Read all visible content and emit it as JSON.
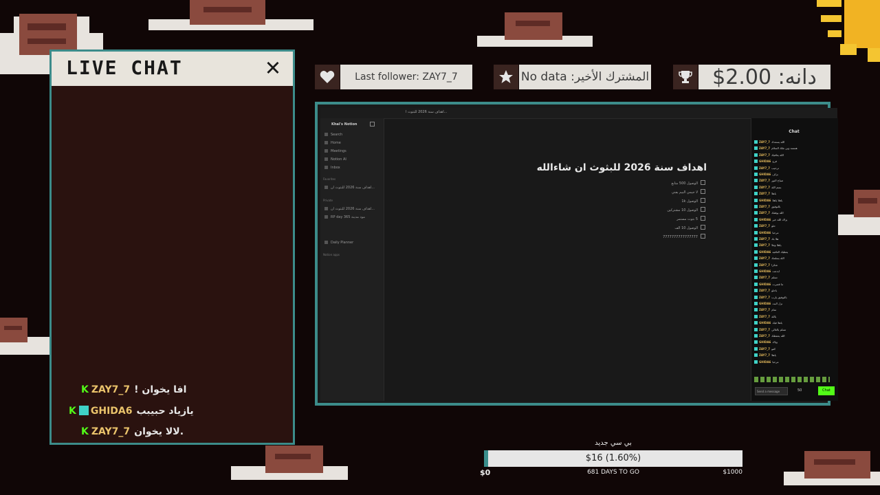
{
  "chat": {
    "title": "LIVE CHAT",
    "close_label": "✕",
    "messages": [
      {
        "platform": "K",
        "username": "ZAY7_7",
        "text": "! افا يخوان"
      },
      {
        "platform": "K",
        "username": "GHIDA6",
        "text": "يازياد حبيبب"
      },
      {
        "platform": "K",
        "username": "ZAY7_7",
        "text": "لالا يخوان."
      }
    ]
  },
  "stats": {
    "follower": {
      "icon": "heart-icon",
      "text": "Last follower: ZAY7_7"
    },
    "subscriber": {
      "icon": "star-icon",
      "text": "المشترك الأخير: No data"
    },
    "donation": {
      "icon": "trophy-icon",
      "text": "دانه: 2.00$"
    }
  },
  "app": {
    "workspace_name": "Khal's Notion",
    "tab_title": "اهداف سنة 2026 للبثوث ا...",
    "sidebar_items": [
      "Search",
      "Home",
      "Meetings",
      "Notion AI",
      "Inbox"
    ],
    "favorites_header": "Favorites",
    "favorites": [
      "اهداف سنة 2026 للبثوث ان..."
    ],
    "private_header": "Private",
    "private_items": [
      "اهداف سنة 2026 للبثوث ان...",
      "RP day 365 مود مدينة"
    ],
    "more_items": [
      "Daily Planner"
    ],
    "footer": "Notion apps",
    "doc_title": "اهداف سنة 2026 للبثوث ان شاءالله",
    "goals": [
      "الوصول 500 متابع",
      "لا جيمي البيم يفني",
      "الوصول 1k",
      "الوصول 10 مشتركين",
      "5 بثوث مستمر",
      "الوصول 10 الف",
      "7777777777777777"
    ]
  },
  "twitch_chat": {
    "title": "Chat",
    "lines": [
      {
        "name": "ZAY7_7",
        "text": "الله يسعدك"
      },
      {
        "name": "ZAY7_7",
        "text": "همسه وين ملك السلام"
      },
      {
        "name": "ZAY7_7",
        "text": "الله يعافيك"
      },
      {
        "name": "GHIDA6",
        "text": "فرج"
      },
      {
        "name": "ZAY7_7",
        "text": "ترحيب"
      },
      {
        "name": "GHIDA6",
        "text": "بزاف"
      },
      {
        "name": "ZAY7_7",
        "text": "صباح النور"
      },
      {
        "name": "ZAY7_7",
        "text": "بسم الله"
      },
      {
        "name": "ZAY7_7",
        "text": "ياهلا"
      },
      {
        "name": "GHIDA6",
        "text": "ياهلا ياهلا"
      },
      {
        "name": "ZAY7_7",
        "text": "بالتوفيق"
      },
      {
        "name": "ZAY7_7",
        "text": "الله يوفقك"
      },
      {
        "name": "GHIDA6",
        "text": "يزاك الله خير"
      },
      {
        "name": "ZAY7_7",
        "text": "حلو"
      },
      {
        "name": "GHIDA6",
        "text": "مرحبا"
      },
      {
        "name": "ZAY7_7",
        "text": "هلا بك"
      },
      {
        "name": "ZAY7_7",
        "text": "ياهلا وغلا"
      },
      {
        "name": "GHIDA6",
        "text": "يعطيك العافية"
      },
      {
        "name": "ZAY7_7",
        "text": "الله يسلمك"
      },
      {
        "name": "ZAY7_7",
        "text": "شكرا"
      },
      {
        "name": "GHIDA6",
        "text": "ابدعت"
      },
      {
        "name": "ZAY7_7",
        "text": "تسلم"
      },
      {
        "name": "GHIDA6",
        "text": "ما قصرت"
      },
      {
        "name": "ZAY7_7",
        "text": "ياحلو"
      },
      {
        "name": "ZAY7_7",
        "text": "بالتوفيق يارب"
      },
      {
        "name": "GHIDA6",
        "text": "نزل البث"
      },
      {
        "name": "ZAY7_7",
        "text": "تمام"
      },
      {
        "name": "ZAY7_7",
        "text": "يالله"
      },
      {
        "name": "GHIDA6",
        "text": "ياهلا فيك"
      },
      {
        "name": "ZAY7_7",
        "text": "تسلم يالغالي"
      },
      {
        "name": "ZAY7_7",
        "text": "الله يحفظك"
      },
      {
        "name": "GHIDA6",
        "text": "وياك"
      },
      {
        "name": "ZAY7_7",
        "text": "كفو"
      },
      {
        "name": "ZAY7_7",
        "text": "ياهلا"
      },
      {
        "name": "GHIDA6",
        "text": "مرحبا"
      }
    ],
    "input_placeholder": "Send a message",
    "send_label": "Chat",
    "points": "50"
  },
  "goal": {
    "title": "بي سي جديد",
    "progress": 0.016,
    "label": "$16 (1.60%)",
    "min": "$0",
    "max": "$1000",
    "days": "681 DAYS TO GO"
  },
  "colors": {
    "background": "#100606",
    "panel_border": "#3c8c8a",
    "chat_bg": "#2a120f",
    "username": "#eac36b",
    "kick_green": "#53fc18"
  }
}
